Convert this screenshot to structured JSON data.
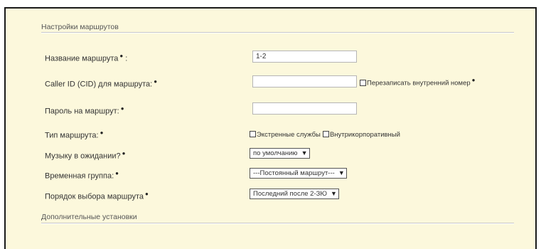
{
  "section_route_settings": {
    "title": "Настройки маршрутов"
  },
  "fields": {
    "route_name": {
      "label": "Название маршрута",
      "suffix": " :",
      "value": "1-2"
    },
    "caller_id": {
      "label": "Caller ID (CID) для маршрута:",
      "value": "",
      "overwrite_label": "Перезаписать внутренний номер"
    },
    "route_password": {
      "label": "Пароль на маршрут:",
      "value": ""
    },
    "route_type": {
      "label": "Тип маршрута:",
      "option1": "Экстренные службы",
      "option2": "Внутрикорпоративный"
    },
    "music_on_hold": {
      "label": "Музыку в ожидании?",
      "value": "по умолчанию"
    },
    "time_group": {
      "label": "Временная группа:",
      "value": "---Постоянный маршрут---"
    },
    "route_order": {
      "label": "Порядок выбора маршрута",
      "value": "Последний после 2-ЗЮ"
    }
  },
  "section_additional": {
    "title": "Дополнительные установки"
  },
  "required_marker": "●"
}
